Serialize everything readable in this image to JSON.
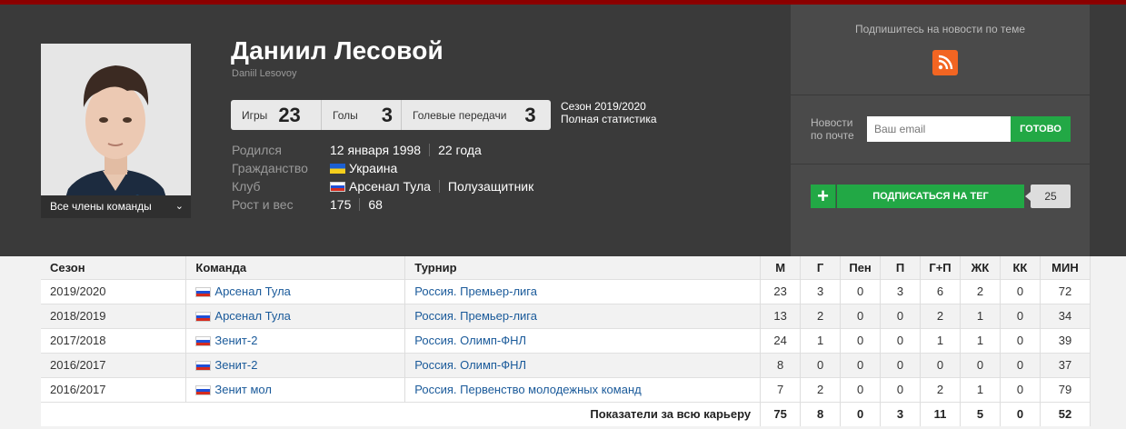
{
  "player": {
    "name": "Даниил Лесовой",
    "name_latin": "Daniil Lesovoy",
    "team_dropdown": "Все члены команды"
  },
  "stats_box": {
    "games_label": "Игры",
    "games": "23",
    "goals_label": "Голы",
    "goals": "3",
    "assists_label": "Голевые передачи",
    "assists": "3"
  },
  "season_info": {
    "season": "Сезон 2019/2020",
    "full_stats": "Полная статистика"
  },
  "bio": {
    "born_label": "Родился",
    "born_date": "12 января 1998",
    "age": "22 года",
    "citizenship_label": "Гражданство",
    "citizenship": "Украина",
    "club_label": "Клуб",
    "club": "Арсенал Тула",
    "position": "Полузащитник",
    "height_weight_label": "Рост и вес",
    "height": "175",
    "weight": "68"
  },
  "subscribe": {
    "title": "Подпишитесь на новости по теме",
    "news_label_1": "Новости",
    "news_label_2": "по почте",
    "email_placeholder": "Ваш email",
    "done_label": "ГОТОВО",
    "plus_label": "+",
    "tag_label": "ПОДПИСАТЬСЯ НА ТЕГ",
    "tag_count": "25"
  },
  "table": {
    "headers": [
      "Сезон",
      "Команда",
      "Турнир",
      "М",
      "Г",
      "Пен",
      "П",
      "Г+П",
      "ЖК",
      "КК",
      "МИН"
    ],
    "rows": [
      [
        "2019/2020",
        "Арсенал Тула",
        "Россия. Премьер-лига",
        "23",
        "3",
        "0",
        "3",
        "6",
        "2",
        "0",
        "72"
      ],
      [
        "2018/2019",
        "Арсенал Тула",
        "Россия. Премьер-лига",
        "13",
        "2",
        "0",
        "0",
        "2",
        "1",
        "0",
        "34"
      ],
      [
        "2017/2018",
        "Зенит-2",
        "Россия. Олимп-ФНЛ",
        "24",
        "1",
        "0",
        "0",
        "1",
        "1",
        "0",
        "39"
      ],
      [
        "2016/2017",
        "Зенит-2",
        "Россия. Олимп-ФНЛ",
        "8",
        "0",
        "0",
        "0",
        "0",
        "0",
        "0",
        "37"
      ],
      [
        "2016/2017",
        "Зенит мол",
        "Россия. Первенство молодежных команд",
        "7",
        "2",
        "0",
        "0",
        "2",
        "1",
        "0",
        "79"
      ]
    ],
    "total_label": "Показатели за всю карьеру",
    "totals": [
      "75",
      "8",
      "0",
      "3",
      "11",
      "5",
      "0",
      "52"
    ]
  },
  "colors": {
    "header_bg": "#3a3a3a",
    "accent_green": "#22a845",
    "rss_orange": "#f26522",
    "link_blue": "#1a5a9a",
    "top_bar": "#8b0000"
  }
}
